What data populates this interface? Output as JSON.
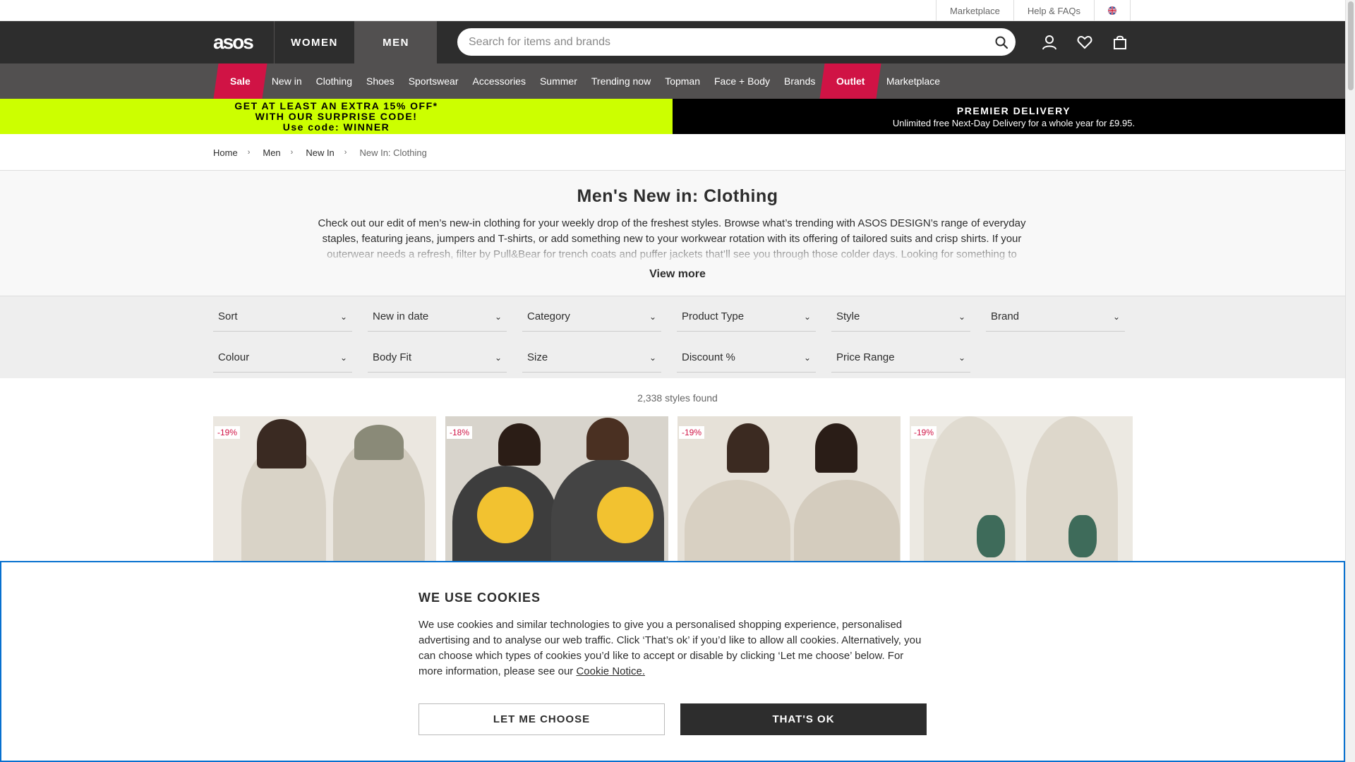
{
  "utility": {
    "links": [
      "Marketplace",
      "Help & FAQs"
    ],
    "flag": "uk-flag-icon"
  },
  "header": {
    "logo": "asos",
    "gender": [
      "WOMEN",
      "MEN"
    ],
    "search_placeholder": "Search for items and brands",
    "icons": [
      "account-icon",
      "heart-icon",
      "bag-icon"
    ]
  },
  "nav": {
    "items": [
      "Sale",
      "New in",
      "Clothing",
      "Shoes",
      "Sportswear",
      "Accessories",
      "Summer",
      "Trending now",
      "Topman",
      "Face + Body",
      "Brands",
      "Outlet",
      "Marketplace"
    ]
  },
  "promo": {
    "left": [
      "GET AT LEAST AN EXTRA 15% OFF*",
      "WITH OUR SURPRISE CODE!",
      "Use code: WINNER"
    ],
    "right_title": "PREMIER DELIVERY",
    "right_sub": "Unlimited free Next-Day Delivery for a whole year for £9.95."
  },
  "breadcrumb": [
    "Home",
    "Men",
    "New In",
    "New In: Clothing"
  ],
  "intro": {
    "title": "Men's New in: Clothing",
    "description": "Check out our edit of men’s new-in clothing for your weekly drop of the freshest styles. Browse what’s trending with ASOS DESIGN’s range of everyday staples, featuring jeans, jumpers and T-shirts, or add something new to your workwear rotation with its offering of tailored suits and crisp shirts. If your outerwear needs a refresh, filter by Pull&Bear for trench coats and puffer jackets that’ll see you through those colder days. Looking for something to slot",
    "view_more": "View more"
  },
  "filters": {
    "row1": [
      "Sort",
      "New in date",
      "Category",
      "Product Type",
      "Style",
      "Brand"
    ],
    "row2": [
      "Colour",
      "Body Fit",
      "Size",
      "Discount %",
      "Price Range"
    ]
  },
  "count": "2,338 styles found",
  "products": [
    {
      "badge": "-19%"
    },
    {
      "badge": "-18%"
    },
    {
      "badge": "-19%"
    },
    {
      "badge": "-19%"
    }
  ],
  "cookie": {
    "title": "WE USE COOKIES",
    "text": "We use cookies and similar technologies to give you a personalised shopping experience, personalised advertising and to analyse our web traffic. Click ‘That’s ok’ if you’d like to allow all cookies. Alternatively, you can choose which types of cookies you’d like to accept or disable by clicking ‘Let me choose’ below. For more information, please see our ",
    "link": "Cookie Notice.",
    "choose": "LET ME CHOOSE",
    "ok": "THAT'S OK"
  }
}
